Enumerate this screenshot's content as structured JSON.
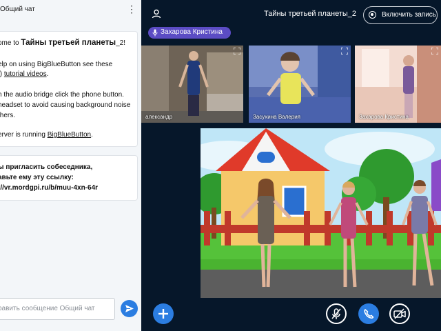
{
  "chat": {
    "title": "Общий чат",
    "welcome": {
      "line1_prefix": "ome to ",
      "line1_name": "Тайны третьей планеты",
      "line1_suffix": "_2!",
      "line2": "elp on using BigBlueButton see these",
      "line3_prefix": "t) ",
      "line3_link": "tutorial videos",
      "line3_suffix": ".",
      "line4": "n the audio bridge click the phone button.",
      "line5": "headset to avoid causing background noise",
      "line6": "thers.",
      "line7_prefix": "erver is running ",
      "line7_link": "BigBlueButton",
      "line7_suffix": "."
    },
    "invite": {
      "line1": "ы пригласить собеседника,",
      "line2": "авьте ему эту ссылку:",
      "line3": "://vr.mordgpi.ru/b/muu-4xn-64r"
    },
    "input_placeholder": "равить сообщение Общий чат"
  },
  "header": {
    "meeting_title": "Тайны третьей планеты_2",
    "record_label": "Включить запись"
  },
  "talking": {
    "name": "Захарова Кристина"
  },
  "tiles": [
    {
      "name": "александр"
    },
    {
      "name": "Засухина Валерия"
    },
    {
      "name": "Захарова Кристина"
    }
  ],
  "colors": {
    "primary": "#2b7de1",
    "talker": "#5b4cc4",
    "background": "#06172a",
    "chat_bg": "#f3f6f9"
  },
  "icons": {
    "user": "user-icon",
    "record": "record-icon",
    "mic": "microphone-icon",
    "fullscreen": "fullscreen-icon",
    "send": "send-icon",
    "plus": "plus-icon",
    "mic_muted": "microphone-muted-icon",
    "phone": "phone-icon",
    "camera_off": "camera-off-icon",
    "kebab": "more-vertical-icon"
  }
}
